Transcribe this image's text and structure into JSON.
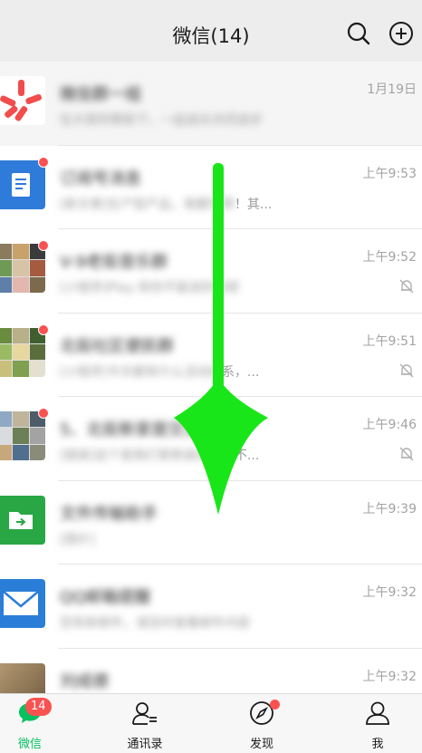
{
  "header": {
    "title": "微信(14)"
  },
  "chats": [
    {
      "title": "微信群一组",
      "preview": "在大家的帮助下，一起成长共同进步",
      "time": "1月19日",
      "avatar": "pinwheel",
      "top": true,
      "dot": false,
      "muted": false
    },
    {
      "title": "订阅号消息",
      "preview_blur": "[新文章]生产型产品，我都觉得",
      "preview_tail": "！其...",
      "time": "上午9:53",
      "avatar": "subscription",
      "top": false,
      "dot": true,
      "muted": false
    },
    {
      "title": "V-9老街音乐群",
      "preview_blur": "[小程序]Play 和你不能说的秘密",
      "preview_tail": "",
      "time": "上午9:52",
      "avatar": "grid",
      "top": false,
      "dot": true,
      "muted": true
    },
    {
      "title": "北街社区便民群",
      "preview_blur": "[小程序]今天都有什么活动好",
      "preview_tail": "系，...",
      "time": "上午9:51",
      "avatar": "grid",
      "top": false,
      "dot": true,
      "muted": true
    },
    {
      "title": "5、北街新家居交流群",
      "preview_blur": "[链接]这个是我们家新装修的",
      "preview_tail": "都不...",
      "time": "上午9:46",
      "avatar": "grid",
      "top": false,
      "dot": true,
      "muted": true
    },
    {
      "title": "文件传输助手",
      "preview_blur": "[图片]",
      "preview_tail": "",
      "time": "上午9:39",
      "avatar": "file",
      "top": false,
      "dot": false,
      "muted": false
    },
    {
      "title": "QQ邮箱提醒",
      "preview_blur": "您有新邮件，请及时查看邮件内容",
      "preview_tail": "",
      "time": "上午9:32",
      "avatar": "mail",
      "top": false,
      "dot": false,
      "muted": false
    },
    {
      "title": "刘成德",
      "preview_blur": "",
      "preview_tail": "",
      "time": "上午9:32",
      "avatar": "photo",
      "top": false,
      "dot": false,
      "muted": false
    }
  ],
  "tabs": [
    {
      "label": "微信",
      "badge": "14"
    },
    {
      "label": "通讯录"
    },
    {
      "label": "发现"
    },
    {
      "label": "我"
    }
  ],
  "colors": {
    "accent": "#07c160",
    "badge": "#fa5151",
    "arrow": "#19e619"
  }
}
